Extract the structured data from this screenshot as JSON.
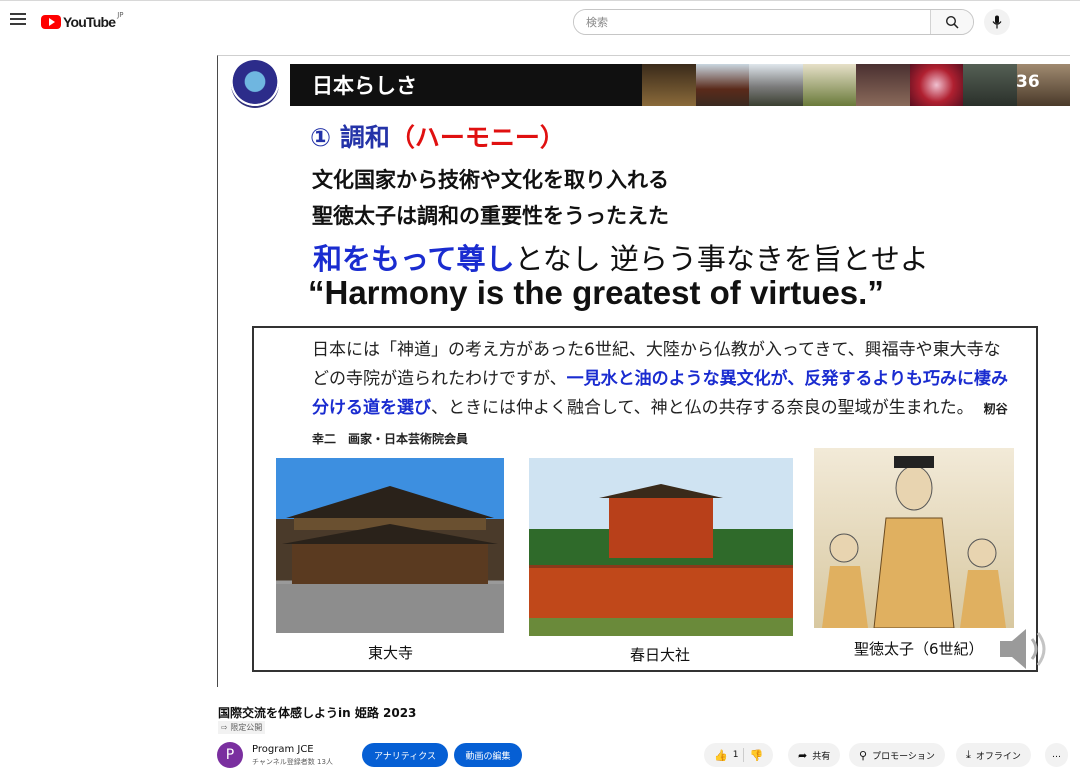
{
  "header": {
    "logo_text": "YouTube",
    "logo_region": "JP",
    "search_placeholder": "検索"
  },
  "slide": {
    "bar_title": "日本らしさ",
    "slide_number": "36",
    "heading_number": "①",
    "heading_main": "調和",
    "heading_paren": "（ハーモニー）",
    "line1": "文化国家から技術や文化を取り入れる",
    "line2": "聖徳太子は調和の重要性をうったえた",
    "motto_blue": "和をもって尊し",
    "motto_rest": "となし 逆らう事なきを旨とせよ",
    "english": "“Harmony is the greatest of virtues.”",
    "quote_part1": "日本には「神道」の考え方があった6世紀、大陸から仏教が入ってきて、興福寺や東大寺などの寺院が造られたわけですが、",
    "quote_blue": "一見水と油のような異文化が、反発するよりも巧みに棲み分ける道を選び",
    "quote_part2": "、ときには仲よく融合して、神と仏の共存する奈良の聖域が生まれた。",
    "quote_attr": "籾谷 幸二　画家・日本芸術院会員",
    "captions": [
      "東大寺",
      "春日大社",
      "聖徳太子（6世紀）"
    ]
  },
  "video": {
    "title": "国際交流を体感しようin 姫路 2023",
    "visibility": "限定公開",
    "channel_initial": "P",
    "channel_name": "Program JCE",
    "subscribers": "チャンネル登録者数 13人",
    "analytics_label": "アナリティクス",
    "edit_label": "動画の編集",
    "like_count": "1",
    "share_label": "共有",
    "promotion_label": "プロモーション",
    "offline_label": "オフライン",
    "more_label": "…"
  }
}
